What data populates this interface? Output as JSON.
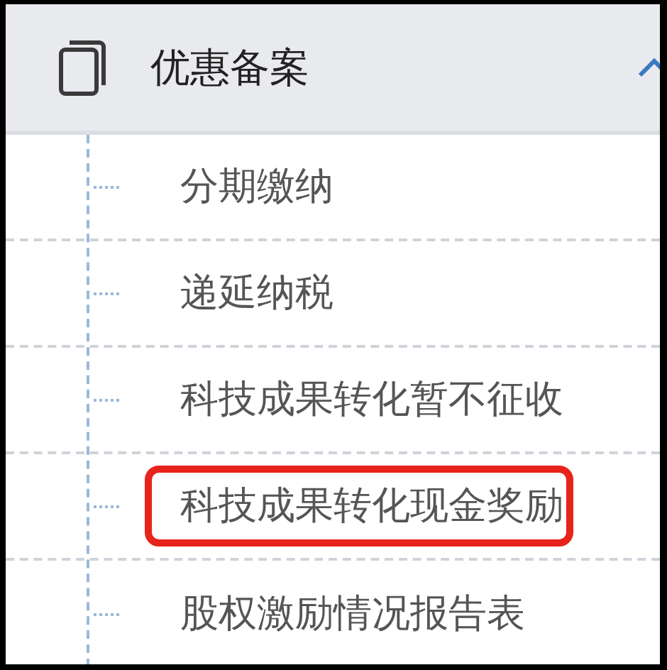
{
  "menu_group": {
    "title": "优惠备案",
    "expanded": true,
    "items": [
      {
        "label": "分期缴纳",
        "highlighted": false
      },
      {
        "label": "递延纳税",
        "highlighted": false
      },
      {
        "label": "科技成果转化暂不征收",
        "highlighted": false
      },
      {
        "label": "科技成果转化现金奖励",
        "highlighted": true
      },
      {
        "label": "股权激励情况报告表",
        "highlighted": false
      }
    ]
  }
}
